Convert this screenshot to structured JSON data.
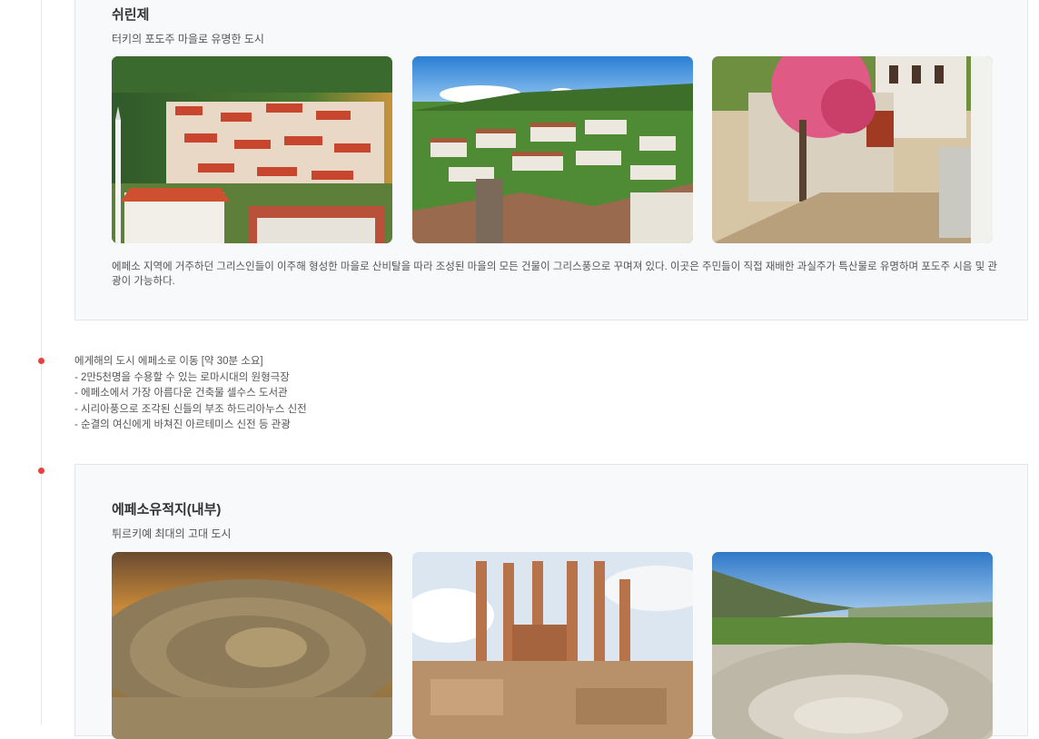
{
  "sections": [
    {
      "title": "쉬린제",
      "subtitle": "터키의 포도주 마을로 유명한 도시",
      "description": "에페소 지역에 거주하던 그리스인들이 이주해 형성한 마을로 산비탈을 따라 조성된 마을의 모든 건물이 그리스풍으로 꾸며져 있다. 이곳은 주민들이 직접 재배한 과실주가 특산물로 유명하며 포도주 시음 및 관광이 가능하다."
    },
    {
      "title": "에페소유적지(내부)",
      "subtitle": "튀르키예 최대의 고대 도시"
    }
  ],
  "itinerary": {
    "heading": "에게해의 도시 에페소로 이동 [약 30분 소요]",
    "items": [
      "- 2만5천명을 수용할 수 있는 로마시대의 원형극장",
      "- 에페소에서 가장 아름다운 건축물 셀수스 도서관",
      "- 시리아풍으로 조각된 신들의 부조 하드리아누스 신전",
      "- 순결의 여신에게 바쳐진 아르테미스 신전 등 관광"
    ]
  },
  "colors": {
    "accent_dot": "#e8403a",
    "card_bg": "#f8f9fb",
    "card_border": "#e3e5ea"
  }
}
